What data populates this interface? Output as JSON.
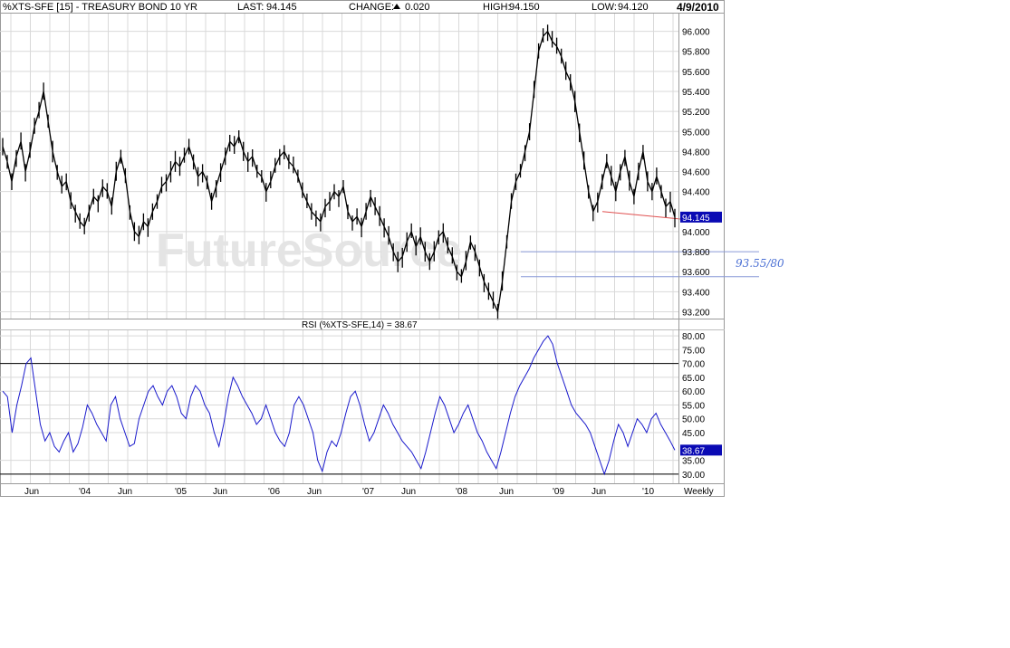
{
  "header": {
    "title": "%XTS-SFE [15] - TREASURY BOND 10 YR",
    "last_label": "LAST:",
    "last_value": "94.145",
    "change_label": "CHANGE:",
    "change_value": "0.020",
    "high_label": "HIGH:",
    "high_value": "94.150",
    "low_label": "LOW:",
    "low_value": "94.120",
    "date": "4/9/2010"
  },
  "watermark": "FutureSource",
  "colors": {
    "price": "#000000",
    "rsi": "#1a1acc",
    "grid": "#d9d9d9",
    "badge": "#0a0ab4",
    "trendline": "#e05050",
    "level": "#8a9ad8",
    "annotation": "#4a6fd4"
  },
  "price_panel": {
    "y_ticks": [
      "96.000",
      "95.800",
      "95.600",
      "95.400",
      "95.200",
      "95.000",
      "94.800",
      "94.600",
      "94.400",
      "94.000",
      "93.800",
      "93.600",
      "93.400",
      "93.200"
    ],
    "last_badge": "94.145",
    "annotation": "93.55/80"
  },
  "rsi_panel": {
    "title": "RSI (%XTS-SFE,14) = 38.67",
    "y_ticks": [
      "80.00",
      "75.00",
      "70.00",
      "65.00",
      "60.00",
      "55.00",
      "50.00",
      "45.00",
      "35.00",
      "30.00"
    ],
    "last_badge": "38.67"
  },
  "x_axis": {
    "labels": [
      "Jun",
      "'04",
      "Jun",
      "'05",
      "Jun",
      "'06",
      "Jun",
      "'07",
      "Jun",
      "'08",
      "Jun",
      "'09",
      "Jun",
      "'10"
    ],
    "period": "Weekly"
  },
  "chart_data": [
    {
      "type": "line",
      "series": [
        {
          "values": [
            94.85,
            94.7,
            94.5,
            94.75,
            94.9,
            94.6,
            94.8,
            95.05,
            95.2,
            95.4,
            95.1,
            94.8,
            94.6,
            94.45,
            94.5,
            94.3,
            94.2,
            94.1,
            94.05,
            94.2,
            94.35,
            94.3,
            94.45,
            94.4,
            94.25,
            94.6,
            94.75,
            94.55,
            94.2,
            94.0,
            93.95,
            94.1,
            94.05,
            94.2,
            94.3,
            94.45,
            94.5,
            94.6,
            94.7,
            94.65,
            94.75,
            94.85,
            94.7,
            94.55,
            94.6,
            94.5,
            94.3,
            94.45,
            94.6,
            94.75,
            94.9,
            94.85,
            94.95,
            94.8,
            94.7,
            94.75,
            94.6,
            94.55,
            94.4,
            94.5,
            94.65,
            94.75,
            94.8,
            94.7,
            94.65,
            94.55,
            94.4,
            94.3,
            94.2,
            94.15,
            94.1,
            94.25,
            94.3,
            94.4,
            94.35,
            94.45,
            94.2,
            94.1,
            94.15,
            94.05,
            94.2,
            94.35,
            94.25,
            94.15,
            94.05,
            93.95,
            93.8,
            93.7,
            93.75,
            93.9,
            94.0,
            93.85,
            93.95,
            93.8,
            93.7,
            93.8,
            93.95,
            94.0,
            93.85,
            93.75,
            93.6,
            93.55,
            93.7,
            93.9,
            93.8,
            93.65,
            93.5,
            93.4,
            93.3,
            93.2,
            93.5,
            93.9,
            94.3,
            94.5,
            94.6,
            94.8,
            95.0,
            95.4,
            95.8,
            95.95,
            96.0,
            95.9,
            95.85,
            95.75,
            95.6,
            95.5,
            95.3,
            95.0,
            94.7,
            94.4,
            94.2,
            94.3,
            94.5,
            94.7,
            94.55,
            94.4,
            94.6,
            94.75,
            94.5,
            94.35,
            94.6,
            94.8,
            94.5,
            94.4,
            94.55,
            94.4,
            94.25,
            94.3,
            94.145
          ]
        }
      ],
      "y_ticks": [
        93.2,
        93.4,
        93.6,
        93.8,
        94.0,
        94.4,
        94.6,
        94.8,
        95.0,
        95.2,
        95.4,
        95.6,
        95.8,
        96.0
      ],
      "ylim": [
        93.15,
        96.15
      ],
      "reference_levels": [
        93.8,
        93.55
      ],
      "trendline": [
        94.2,
        94.11
      ],
      "last_value": 94.145
    },
    {
      "type": "line",
      "series": [
        {
          "values": [
            60,
            58,
            45,
            55,
            62,
            70,
            72,
            60,
            48,
            42,
            45,
            40,
            38,
            42,
            45,
            38,
            41,
            47,
            55,
            52,
            48,
            45,
            42,
            55,
            58,
            50,
            45,
            40,
            41,
            50,
            55,
            60,
            62,
            58,
            55,
            60,
            62,
            58,
            52,
            50,
            58,
            62,
            60,
            55,
            52,
            45,
            40,
            48,
            58,
            65,
            62,
            58,
            55,
            52,
            48,
            50,
            55,
            50,
            45,
            42,
            40,
            45,
            55,
            58,
            55,
            50,
            45,
            35,
            31,
            38,
            42,
            40,
            45,
            52,
            58,
            60,
            55,
            48,
            42,
            45,
            50,
            55,
            52,
            48,
            45,
            42,
            40,
            38,
            35,
            32,
            38,
            45,
            52,
            58,
            55,
            50,
            45,
            48,
            52,
            55,
            50,
            45,
            42,
            38,
            35,
            32,
            38,
            45,
            52,
            58,
            62,
            65,
            68,
            72,
            75,
            78,
            80,
            77,
            70,
            65,
            60,
            55,
            52,
            50,
            48,
            45,
            40,
            35,
            30,
            35,
            42,
            48,
            45,
            40,
            45,
            50,
            48,
            45,
            50,
            52,
            48,
            45,
            42,
            38.67
          ]
        }
      ],
      "y_ticks": [
        30,
        35,
        45,
        50,
        55,
        60,
        65,
        70,
        75,
        80
      ],
      "ylim": [
        27,
        82
      ],
      "reference_levels": [
        70,
        30
      ],
      "last_value": 38.67
    }
  ]
}
